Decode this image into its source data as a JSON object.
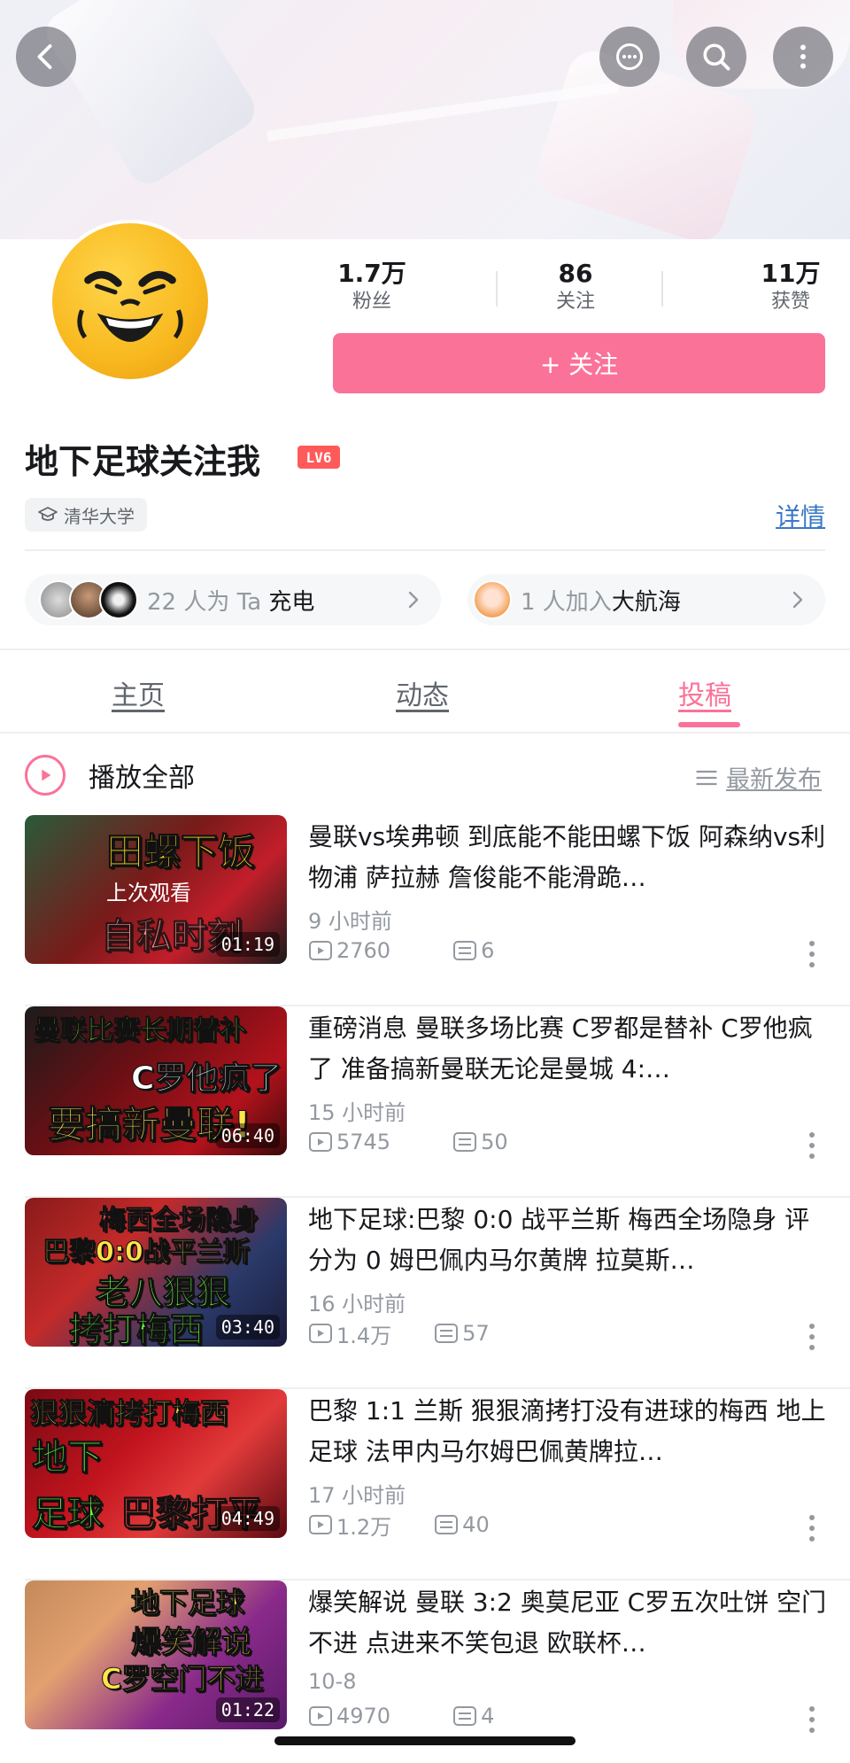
{
  "profile": {
    "followers_num": "1.7万",
    "followers_label": "粉丝",
    "following_num": "86",
    "following_label": "关注",
    "likes_num": "11万",
    "likes_label": "获赞",
    "follow_button": "+ 关注",
    "username": "地下足球关注我",
    "level": "LV6",
    "school": "清华大学",
    "detail_link": "详情"
  },
  "charge": {
    "text": "22 人为 Ta ",
    "highlight": "充电"
  },
  "crew": {
    "text": "1 人加入",
    "highlight": "大航海"
  },
  "tabs": [
    {
      "label": "主页"
    },
    {
      "label": "动态"
    },
    {
      "label": "投稿"
    }
  ],
  "list_header": {
    "play_all": "播放全部",
    "sort": "最新发布"
  },
  "videos": [
    {
      "title": "曼联vs埃弗顿 到底能不能田螺下饭 阿森纳vs利物浦 萨拉赫 詹俊能不能滑跪…",
      "time": "9 小时前",
      "plays": "2760",
      "comments": "6",
      "duration": "01:19",
      "caption1": "田螺下饭",
      "caption2": "自私时刻",
      "watched": "上次观看"
    },
    {
      "title": "重磅消息 曼联多场比赛 C罗都是替补 C罗他疯了 准备搞新曼联无论是曼城 4:…",
      "time": "15 小时前",
      "plays": "5745",
      "comments": "50",
      "duration": "06:40",
      "caption1": "曼联比赛长期替补",
      "caption2": "C罗他疯了",
      "caption3": "要搞新曼联!"
    },
    {
      "title": "地下足球:巴黎 0:0 战平兰斯  梅西全场隐身 评分为 0 姆巴佩内马尔黄牌 拉莫斯…",
      "time": "16 小时前",
      "plays": "1.4万",
      "comments": "57",
      "duration": "03:40",
      "caption1": "梅西全场隐身",
      "caption2": "巴黎0:0战平兰斯",
      "caption3": "老八狠狠",
      "caption4": "拷打梅西"
    },
    {
      "title": "巴黎 1:1 兰斯 狠狠滴拷打没有进球的梅西 地上足球 法甲内马尔姆巴佩黄牌拉…",
      "time": "17 小时前",
      "plays": "1.2万",
      "comments": "40",
      "duration": "04:49",
      "caption1": "狠狠滴拷打梅西",
      "caption2": "地下",
      "caption3": "足球",
      "caption4": "巴黎打平"
    },
    {
      "title": "爆笑解说 曼联 3:2 奥莫尼亚 C罗五次吐饼 空门不进 点进来不笑包退 欧联杯…",
      "time": "10-8",
      "plays": "4970",
      "comments": "4",
      "duration": "01:22",
      "caption1": "地下足球",
      "caption2": "爆笑解说",
      "caption3": "C罗空门不进"
    }
  ],
  "colors": {
    "accent": "#fb7299",
    "link": "#3a78c6",
    "level_badge": "#ff5a5a"
  }
}
